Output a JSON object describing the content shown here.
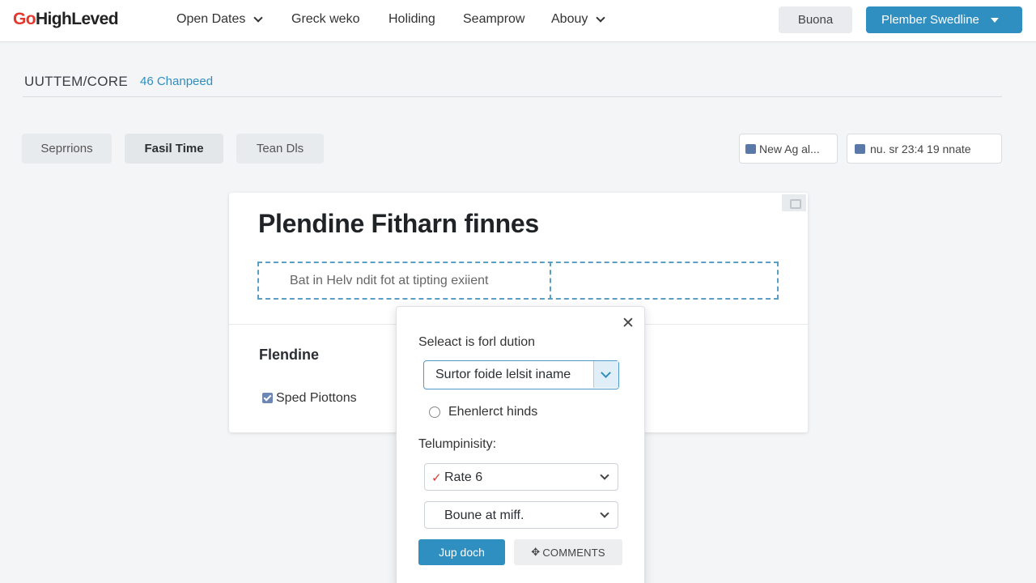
{
  "brand": {
    "logo_prefix": "Go",
    "logo_rest": "HighLeved"
  },
  "nav": {
    "items": [
      {
        "label": "Open Dates",
        "has_dropdown": true
      },
      {
        "label": "Greck weko",
        "has_dropdown": false
      },
      {
        "label": "Holiding",
        "has_dropdown": false
      },
      {
        "label": "Seamprow",
        "has_dropdown": false
      },
      {
        "label": "Abouy",
        "has_dropdown": true
      }
    ],
    "secondary_button": "Buona",
    "primary_button": "Plember Swedline"
  },
  "section": {
    "title": "UUTTEM/CORE",
    "count": "46 Chanpeed"
  },
  "tabs": [
    {
      "label": "Seprrions",
      "active": false
    },
    {
      "label": "Fasil Time",
      "active": true
    },
    {
      "label": "Tean Dls",
      "active": false
    }
  ],
  "chips": [
    {
      "label": "New Ag al...",
      "icon": "calendar-icon"
    },
    {
      "label": "nu. sr 23:4 19 nnate",
      "icon": "clock-icon"
    }
  ],
  "card": {
    "title": "Plendine Fitharn finnes",
    "input_text": "Bat in Helv ndit fot at tipting exiient",
    "subheading": "Flendine",
    "checkbox_label": "Sped Piottons",
    "checkbox_checked": true
  },
  "popover": {
    "label_select": "Seleact is forl dution",
    "select_value": "Surtor foide lelsit iname",
    "radio_label": "Ehenlerct hinds",
    "label_second": "Telumpinisity:",
    "select_rate": "Rate 6",
    "select_rate_marker": "✓",
    "select_bounce": "Boune at miff.",
    "primary_button": "Jup doch",
    "secondary_button": "COMMENTS",
    "secondary_icon": "✥"
  },
  "colors": {
    "accent": "#2f8fc0",
    "logo_accent": "#e4382e",
    "check_red": "#d33b33"
  }
}
